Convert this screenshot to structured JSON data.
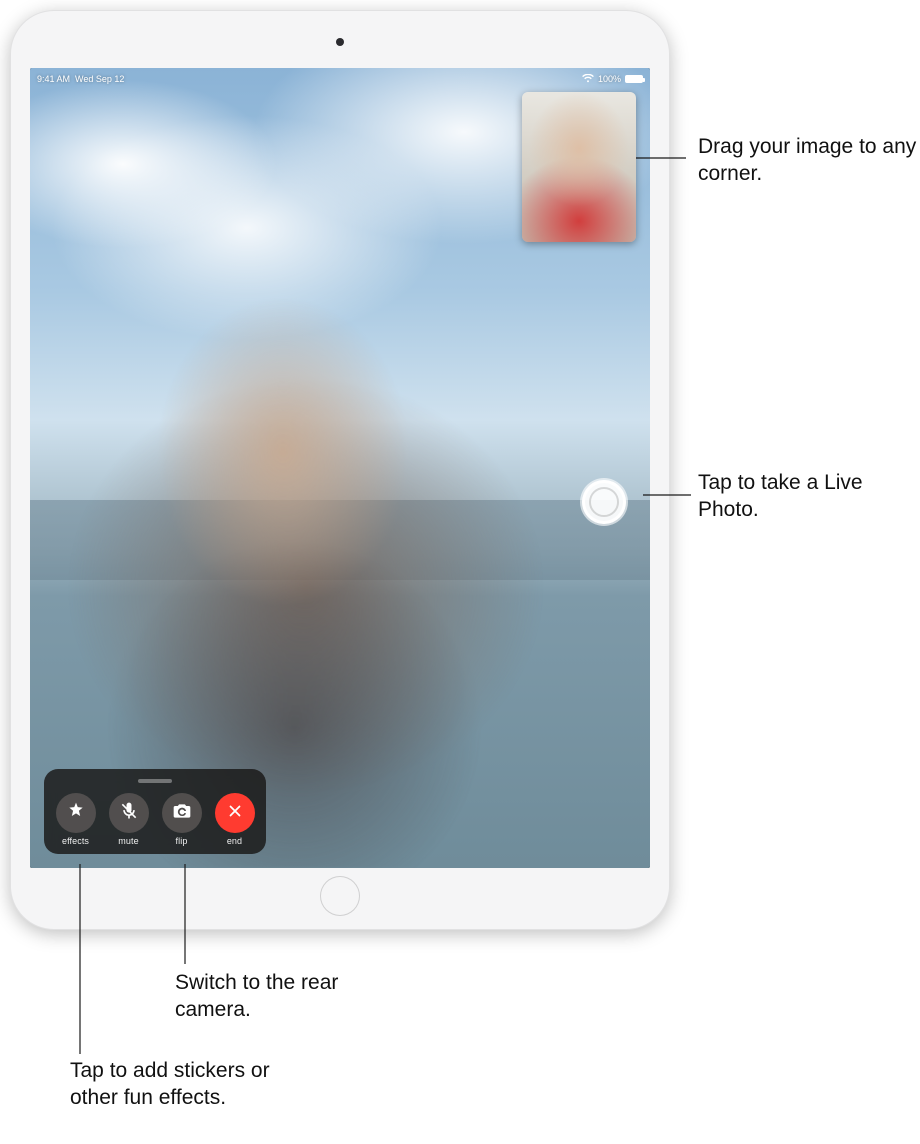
{
  "status_bar": {
    "time": "9:41 AM",
    "date": "Wed Sep 12",
    "battery_pct": "100%"
  },
  "controls": {
    "effects": "effects",
    "mute": "mute",
    "flip": "flip",
    "end": "end"
  },
  "callouts": {
    "pip": "Drag your image to any corner.",
    "capture": "Tap to take a Live Photo.",
    "flip": "Switch to the rear camera.",
    "effects": "Tap to add stickers or other fun effects."
  }
}
